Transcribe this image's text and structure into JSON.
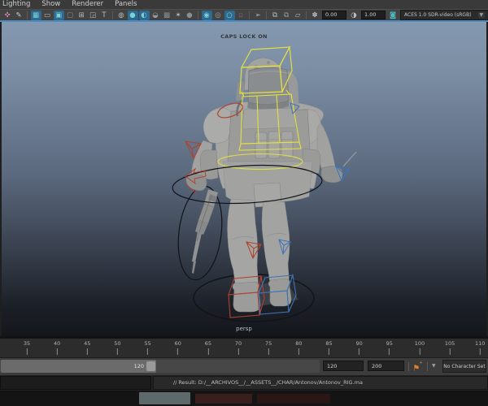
{
  "panel_menu": {
    "items": [
      "Lighting",
      "Show",
      "Renderer",
      "Panels"
    ]
  },
  "panel_toolbar": {
    "items": [
      {
        "type": "icon",
        "name": "multi-component-icon",
        "glyph": "✜",
        "color": "#cf7fae"
      },
      {
        "type": "icon",
        "name": "paint-tool-icon",
        "glyph": "✎",
        "color": "#c9cbcc"
      },
      {
        "type": "sep"
      },
      {
        "type": "icon",
        "name": "single-pane-layout-icon",
        "glyph": "▦",
        "color": "#7ed0d8",
        "active": true
      },
      {
        "type": "icon",
        "name": "four-view-layout-icon",
        "glyph": "▭",
        "color": "#b9bcbd"
      },
      {
        "type": "icon",
        "name": "pane-layout-icon",
        "glyph": "▣",
        "color": "#7ed0d8",
        "active": true
      },
      {
        "type": "icon",
        "name": "pane-layout-dim-icon",
        "glyph": "▢",
        "color": "#8a8d8e"
      },
      {
        "type": "icon",
        "name": "split-pane-layout-icon",
        "glyph": "⊞",
        "color": "#b9bcbd"
      },
      {
        "type": "icon",
        "name": "corner-pane-layout-icon",
        "glyph": "◲",
        "color": "#b9bcbd"
      },
      {
        "type": "icon",
        "name": "panel-editor-icon",
        "glyph": "T",
        "color": "#b9bcbd"
      },
      {
        "type": "sep"
      },
      {
        "type": "icon",
        "name": "wireframe-display-icon",
        "glyph": "◍",
        "color": "#b9bcbd"
      },
      {
        "type": "icon",
        "name": "shaded-display-icon",
        "glyph": "●",
        "color": "#7ed0d8",
        "active": true
      },
      {
        "type": "icon",
        "name": "textured-display-icon",
        "glyph": "◐",
        "color": "#7ed0d8",
        "active": true
      },
      {
        "type": "icon",
        "name": "material-display-icon",
        "glyph": "◒",
        "color": "#9a9d9e"
      },
      {
        "type": "icon",
        "name": "checker-display-icon",
        "glyph": "▩",
        "color": "#8a8d8e"
      },
      {
        "type": "icon",
        "name": "lights-display-icon",
        "glyph": "✶",
        "color": "#b9bcbd"
      },
      {
        "type": "icon",
        "name": "shadows-display-icon",
        "glyph": "●",
        "color": "#8a8d8e"
      },
      {
        "type": "sep"
      },
      {
        "type": "icon",
        "name": "screen-space-ao-icon",
        "glyph": "◉",
        "color": "#7ed0d8",
        "active": true
      },
      {
        "type": "icon",
        "name": "motion-blur-icon",
        "glyph": "◎",
        "color": "#9a9d9e"
      },
      {
        "type": "icon",
        "name": "anti-aliasing-icon",
        "glyph": "○",
        "color": "#7ed0d8",
        "active": true
      },
      {
        "type": "icon",
        "name": "display-toggle-dim-icon",
        "glyph": "▫",
        "color": "#6f7273"
      },
      {
        "type": "sep"
      },
      {
        "type": "icon",
        "name": "select-tool-icon",
        "glyph": "➢",
        "color": "#b9bcbd"
      },
      {
        "type": "sep"
      },
      {
        "type": "icon",
        "name": "isolate-select-icon",
        "glyph": "⧉",
        "color": "#b9bcbd"
      },
      {
        "type": "icon",
        "name": "isolate-selected-icon",
        "glyph": "⧉",
        "color": "#9a9d9e"
      },
      {
        "type": "icon",
        "name": "image-plane-icon",
        "glyph": "▱",
        "color": "#b9bcbd"
      },
      {
        "type": "sep"
      },
      {
        "type": "icon",
        "name": "exposure-icon",
        "glyph": "✽",
        "color": "#b9bcbd"
      },
      {
        "type": "field",
        "name": "exposure-field",
        "value": "0.00"
      },
      {
        "type": "icon",
        "name": "gamma-icon",
        "glyph": "◑",
        "color": "#b9bcbd"
      },
      {
        "type": "field",
        "name": "gamma-field",
        "value": "1.00"
      },
      {
        "type": "icon",
        "name": "view-transform-icon",
        "glyph": "◙",
        "color": "#49b8c4"
      },
      {
        "type": "select",
        "name": "view-transform-select",
        "value": "ACES 1.0 SDR-video (sRGB)"
      }
    ]
  },
  "viewport": {
    "hud_warning": "CAPS LOCK ON",
    "camera": "persp"
  },
  "time_slider": {
    "ticks": [
      35,
      40,
      45,
      50,
      55,
      60,
      65,
      70,
      75,
      80,
      85,
      90,
      95,
      100,
      105,
      110
    ]
  },
  "range_slider": {
    "range_end_handle": "120",
    "playback_end": "120",
    "animation_end": "200",
    "character_set": "No Character Set"
  },
  "command_line": {
    "result": "// Result: D:/__ARCHIVOS__/__ASSETS__/CHAR/Antonov/Antonov_RIG.ma"
  },
  "colors": {
    "rig_yellow": "#e3df3f",
    "rig_red": "#b0412f",
    "rig_blue": "#3f74b4",
    "rig_black": "#111318",
    "active_panel_border": "#4e8cc2",
    "autokey_orange": "#e0802a",
    "viewport_gradient_top": "#8498b0",
    "viewport_gradient_bottom": "#14161b"
  }
}
